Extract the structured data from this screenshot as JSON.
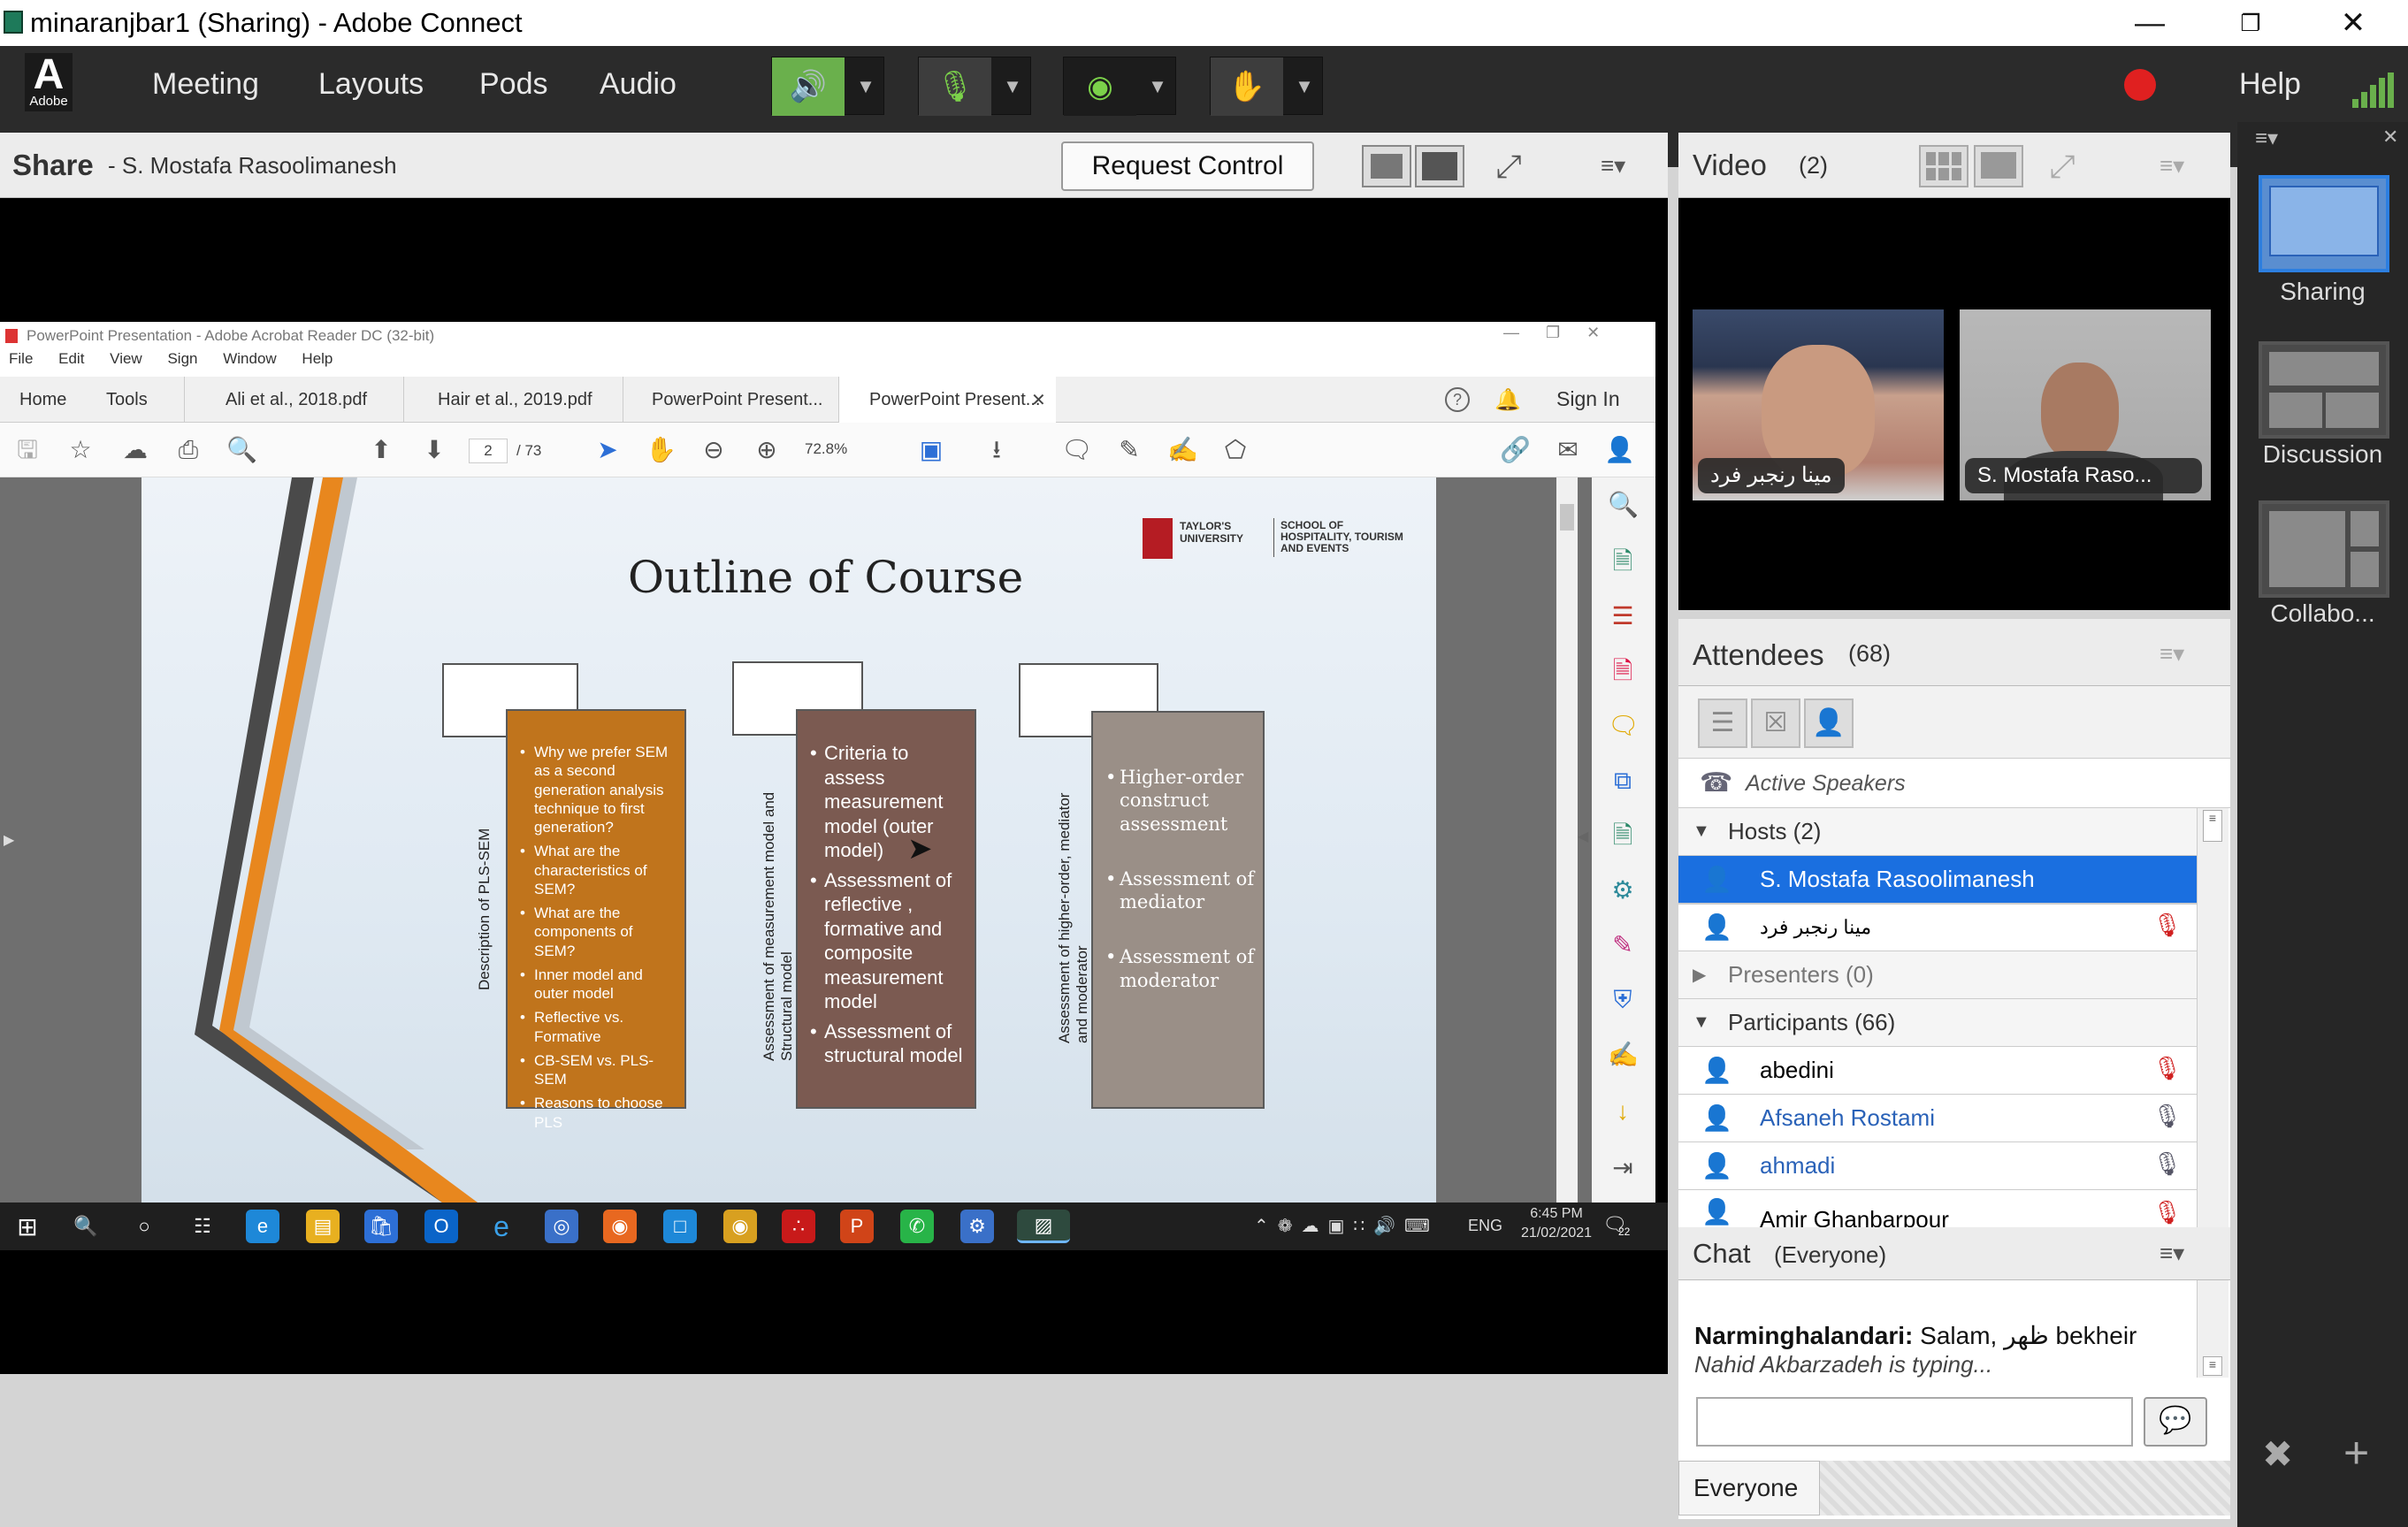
{
  "window": {
    "title": "minaranjbar1 (Sharing) - Adobe Connect"
  },
  "menubar": {
    "logo": "Adobe",
    "items": [
      "Meeting",
      "Layouts",
      "Pods",
      "Audio"
    ],
    "help": "Help",
    "record_color": "#e02020"
  },
  "share": {
    "title": "Share",
    "presenter": "- S. Mostafa Rasoolimanesh",
    "request_control": "Request Control"
  },
  "acrobat": {
    "caption": "PowerPoint Presentation - Adobe Acrobat Reader DC (32-bit)",
    "menu": [
      "File",
      "Edit",
      "View",
      "Sign",
      "Window",
      "Help"
    ],
    "tabs": [
      "Home",
      "Tools",
      "Ali et al., 2018.pdf",
      "Hair et al., 2019.pdf",
      "PowerPoint Present...",
      "PowerPoint Present..."
    ],
    "sign_in": "Sign In",
    "page_current": "2",
    "page_total": "/ 73",
    "zoom": "72.8%"
  },
  "slide": {
    "title": "Outline of  Course",
    "logo_left": "TAYLOR'S UNIVERSITY",
    "logo_right": "SCHOOL OF HOSPITALITY, TOURISM AND EVENTS",
    "col1": {
      "label": "Description of PLS-SEM",
      "items": [
        "Why we prefer SEM as a second generation analysis technique to first generation?",
        "What are the characteristics of SEM?",
        "What are the components of SEM?",
        "Inner model and outer model",
        "Reflective vs. Formative",
        "CB-SEM vs. PLS-SEM",
        "Reasons to choose PLS"
      ]
    },
    "col2": {
      "label": "Assessment of measurement model and Structural model",
      "items": [
        "Criteria to assess measurement model (outer model)",
        "Assessment of reflective , formative and composite measurement model",
        "Assessment of structural model"
      ]
    },
    "col3": {
      "label": "Assessment of higher-order, mediator and moderator",
      "items": [
        "Higher-order construct assessment",
        "Assessment of mediator",
        "Assessment of moderator"
      ]
    }
  },
  "taskbar": {
    "lang": "ENG",
    "time": "6:45 PM",
    "date": "21/02/2021",
    "notif": "22"
  },
  "video": {
    "title": "Video",
    "count": "(2)",
    "tiles": [
      "مینا رنجبر فرد",
      "S. Mostafa Raso..."
    ]
  },
  "attendees": {
    "title": "Attendees",
    "count": "(68)",
    "active_speakers": "Active Speakers",
    "hosts_label": "Hosts (2)",
    "hosts": [
      "S. Mostafa Rasoolimanesh",
      "مینا رنجبر فرد"
    ],
    "presenters_label": "Presenters (0)",
    "participants_label": "Participants (66)",
    "participants": [
      "abedini",
      "Afsaneh Rostami",
      "ahmadi",
      "Amir Ghanbarpour"
    ]
  },
  "chat": {
    "title": "Chat",
    "scope": "(Everyone)",
    "sender": "Narminghalandari:",
    "message": "Salam, ظهر bekheir",
    "typing": "Nahid Akbarzadeh is typing...",
    "recipient": "Everyone"
  },
  "layouts": {
    "items": [
      "Sharing",
      "Discussion",
      "Collabo..."
    ]
  }
}
